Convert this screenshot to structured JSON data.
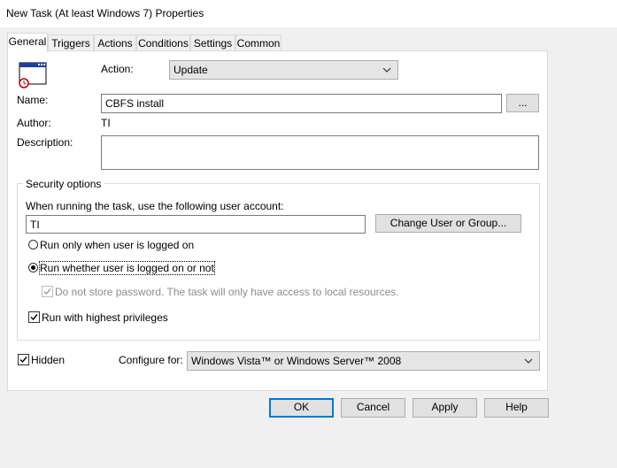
{
  "window": {
    "title": "New Task (At least Windows 7) Properties"
  },
  "tabs": [
    {
      "label": "General",
      "active": true
    },
    {
      "label": "Triggers"
    },
    {
      "label": "Actions"
    },
    {
      "label": "Conditions"
    },
    {
      "label": "Settings"
    },
    {
      "label": "Common"
    }
  ],
  "general": {
    "task_icon": "task-window-clock-icon",
    "action_label": "Action:",
    "action_value": "Update",
    "name_label": "Name:",
    "name_value": "CBFS install",
    "browse_label": "...",
    "author_label": "Author:",
    "author_value": "TI",
    "description_label": "Description:",
    "description_value": ""
  },
  "security": {
    "title": "Security options",
    "account_prompt": "When running the task, use the following user account:",
    "account_value": "TI",
    "change_button": "Change User or Group...",
    "radio_logged_on": {
      "label": "Run only when user is logged on",
      "selected": false
    },
    "radio_whether": {
      "label": "Run whether user is logged on or not",
      "selected": true
    },
    "no_store_password": {
      "label": "Do not store password. The task will only have access to local resources.",
      "checked": true,
      "enabled": false
    },
    "highest_privileges": {
      "label": "Run with highest privileges",
      "checked": true
    }
  },
  "bottom": {
    "hidden": {
      "label": "Hidden",
      "checked": true
    },
    "configure_label": "Configure for:",
    "configure_value": "Windows Vista™ or Windows Server™ 2008"
  },
  "buttons": {
    "ok": "OK",
    "cancel": "Cancel",
    "apply": "Apply",
    "help": "Help"
  },
  "colors": {
    "focus_border": "#0078d7",
    "panel_bg": "#ffffff",
    "window_bg": "#f0f0f0"
  }
}
